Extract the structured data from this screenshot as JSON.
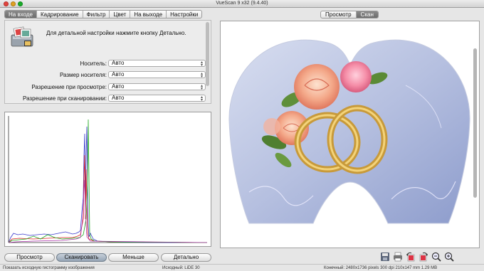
{
  "window": {
    "title": "VueScan 9 x32 (9.4.40)"
  },
  "left_tabs": [
    {
      "label": "На входе",
      "active": true
    },
    {
      "label": "Кадрирование",
      "active": false
    },
    {
      "label": "Фильтр",
      "active": false
    },
    {
      "label": "Цвет",
      "active": false
    },
    {
      "label": "На выходе",
      "active": false
    },
    {
      "label": "Настройки",
      "active": false
    }
  ],
  "info": {
    "text": "Для детальной настройки нажмите кнопку Детально.",
    "icon": "scanner-photos-icon"
  },
  "settings": [
    {
      "label": "Носитель:",
      "value": "Авто"
    },
    {
      "label": "Размер носителя:",
      "value": "Авто"
    },
    {
      "label": "Разрешение при просмотре:",
      "value": "Авто"
    },
    {
      "label": "Разрешение при сканировании:",
      "value": "Авто"
    }
  ],
  "buttons": {
    "preview": "Просмотр",
    "scan": "Сканировать",
    "less": "Меньше",
    "more": "Детально"
  },
  "right_tabs": [
    {
      "label": "Просмотр",
      "active": false
    },
    {
      "label": "Скан",
      "active": true
    }
  ],
  "toolbar_icons": [
    "save-icon",
    "print-icon",
    "rotate-left-icon",
    "rotate-right-icon",
    "zoom-out-icon",
    "zoom-in-icon"
  ],
  "status": {
    "left": "Показать исходную гистограмму изображения",
    "middle": "Исходный: LiDE 30",
    "right": "Конечный: 2480x1736 pixels 300 dpi 210x147 mm 1.29 MB"
  },
  "colors": {
    "accent_tab": "#7a7a7a",
    "histogram_red": "#d22",
    "histogram_green": "#2a2",
    "histogram_blue": "#33c"
  }
}
